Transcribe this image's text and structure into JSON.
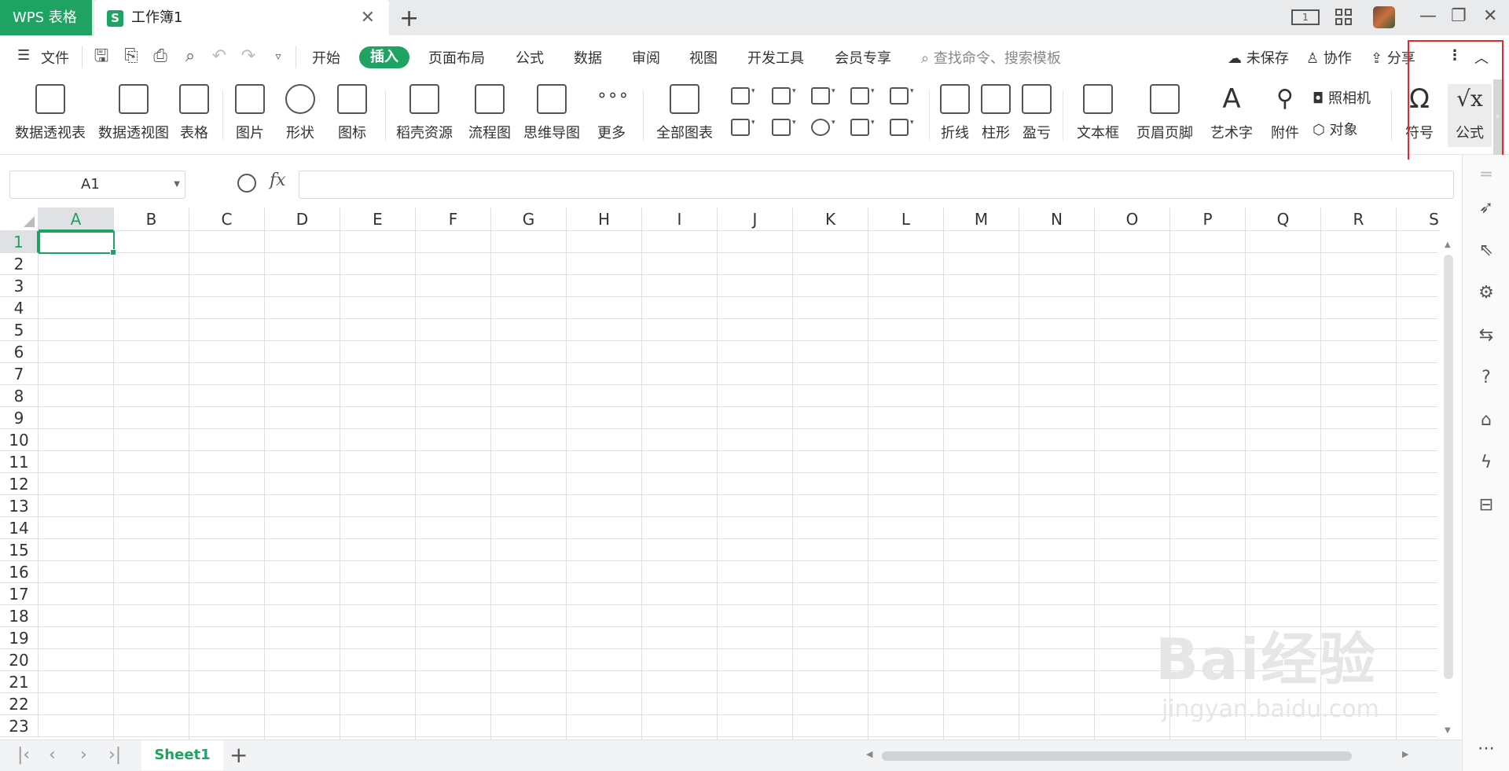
{
  "titlebar": {
    "app_tab": "WPS 表格",
    "doc_tab_icon_letter": "S",
    "doc_tab_name": "工作簿1",
    "layout_badge": "1"
  },
  "menubar": {
    "file": "文件",
    "tabs": [
      "开始",
      "插入",
      "页面布局",
      "公式",
      "数据",
      "审阅",
      "视图",
      "开发工具",
      "会员专享"
    ],
    "active_tab": "插入",
    "search_placeholder": "查找命令、搜索模板",
    "unsaved": "未保存",
    "collab": "协作",
    "share": "分享"
  },
  "ribbon": {
    "pivot_table": "数据透视表",
    "pivot_chart": "数据透视图",
    "table": "表格",
    "picture": "图片",
    "shape": "形状",
    "icon": "图标",
    "docer": "稻壳资源",
    "flowchart": "流程图",
    "mindmap": "思维导图",
    "more": "更多",
    "all_charts": "全部图表",
    "line": "折线",
    "column": "柱形",
    "winloss": "盈亏",
    "textbox": "文本框",
    "header_footer": "页眉页脚",
    "wordart": "艺术字",
    "attachment": "附件",
    "camera": "照相机",
    "object": "对象",
    "symbol": "符号",
    "formula": "公式"
  },
  "formula_bar": {
    "name_box": "A1",
    "fx_label": "fx",
    "value": ""
  },
  "grid": {
    "columns": [
      "A",
      "B",
      "C",
      "D",
      "E",
      "F",
      "G",
      "H",
      "I",
      "J",
      "K",
      "L",
      "M",
      "N",
      "O",
      "P",
      "Q",
      "R",
      "S"
    ],
    "rows": [
      "1",
      "2",
      "3",
      "4",
      "5",
      "6",
      "7",
      "8",
      "9",
      "10",
      "11",
      "12",
      "13",
      "14",
      "15",
      "16",
      "17",
      "18",
      "19",
      "20",
      "21",
      "22",
      "23"
    ],
    "active_cell": "A1"
  },
  "sheets": {
    "tabs": [
      "Sheet1"
    ],
    "active": "Sheet1"
  },
  "colors": {
    "accent": "#1fa363",
    "highlight_box": "#e8262b"
  },
  "watermark": {
    "brand": "Bai经验",
    "url": "jingyan.baidu.com"
  }
}
